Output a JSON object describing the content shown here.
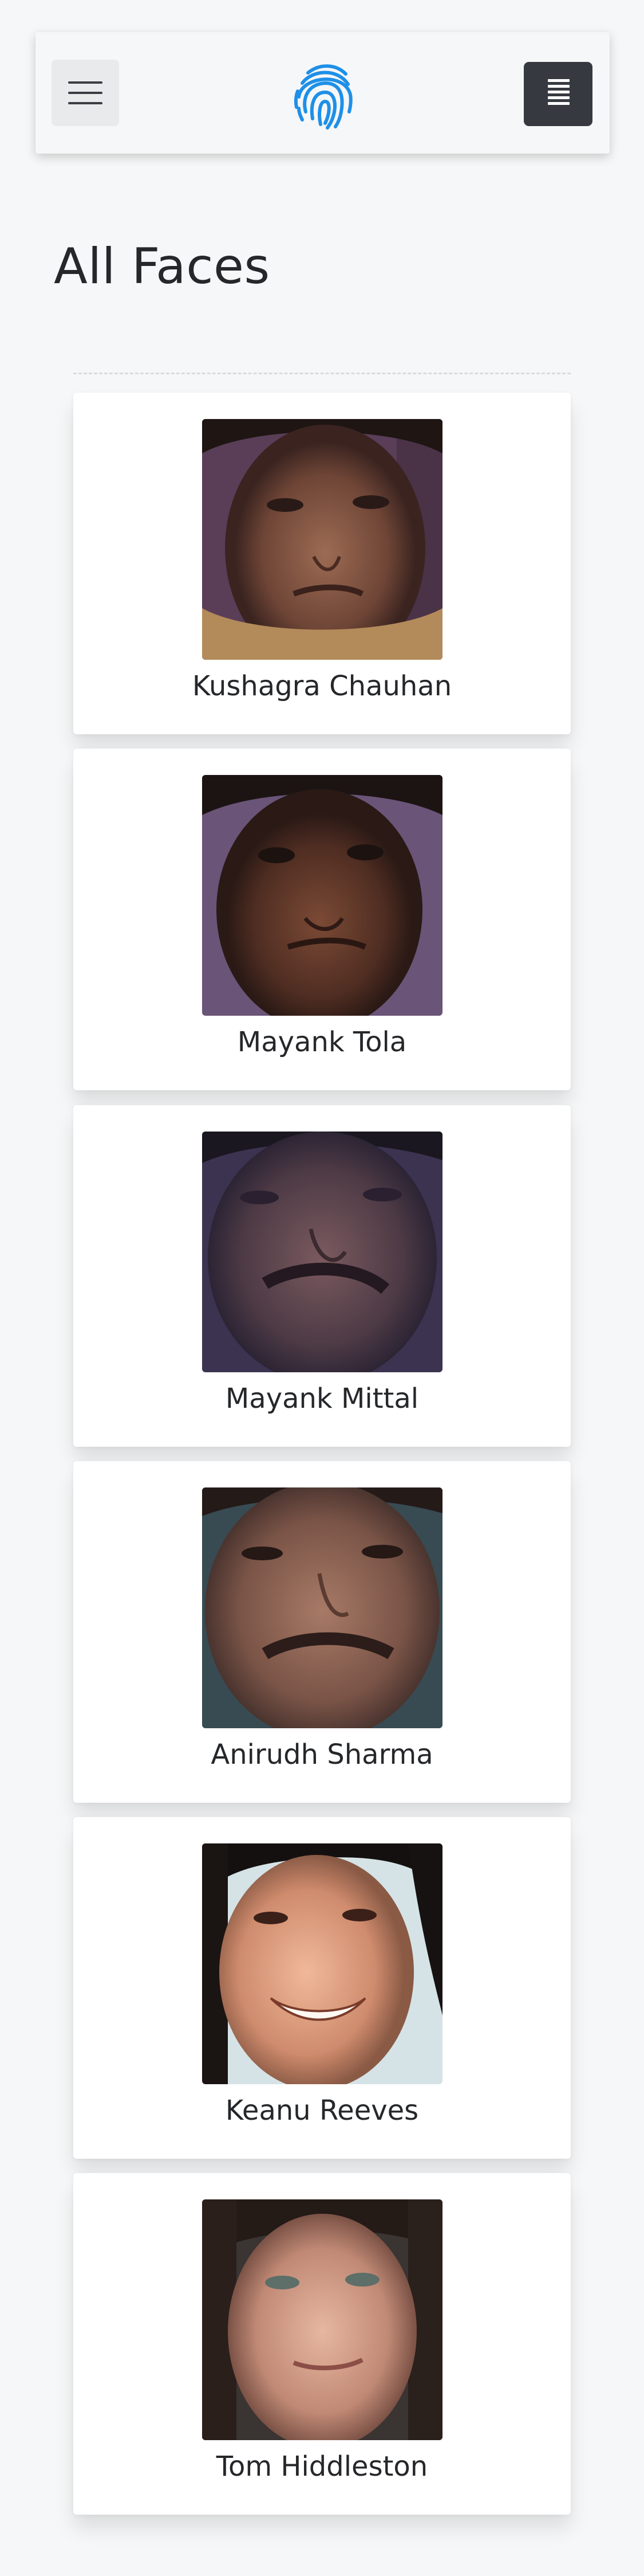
{
  "header": {
    "menu_toggle_icon": "hamburger-menu-icon",
    "logo_icon": "fingerprint-icon",
    "action_icon": "list-icon",
    "logo_color": "#1e90e8",
    "action_bg_color": "#363a40"
  },
  "page": {
    "title": "All Faces"
  },
  "faces": [
    {
      "name": "Kushagra Chauhan"
    },
    {
      "name": "Mayank Tola"
    },
    {
      "name": "Mayank Mittal"
    },
    {
      "name": "Anirudh Sharma"
    },
    {
      "name": "Keanu Reeves"
    },
    {
      "name": "Tom Hiddleston"
    }
  ]
}
